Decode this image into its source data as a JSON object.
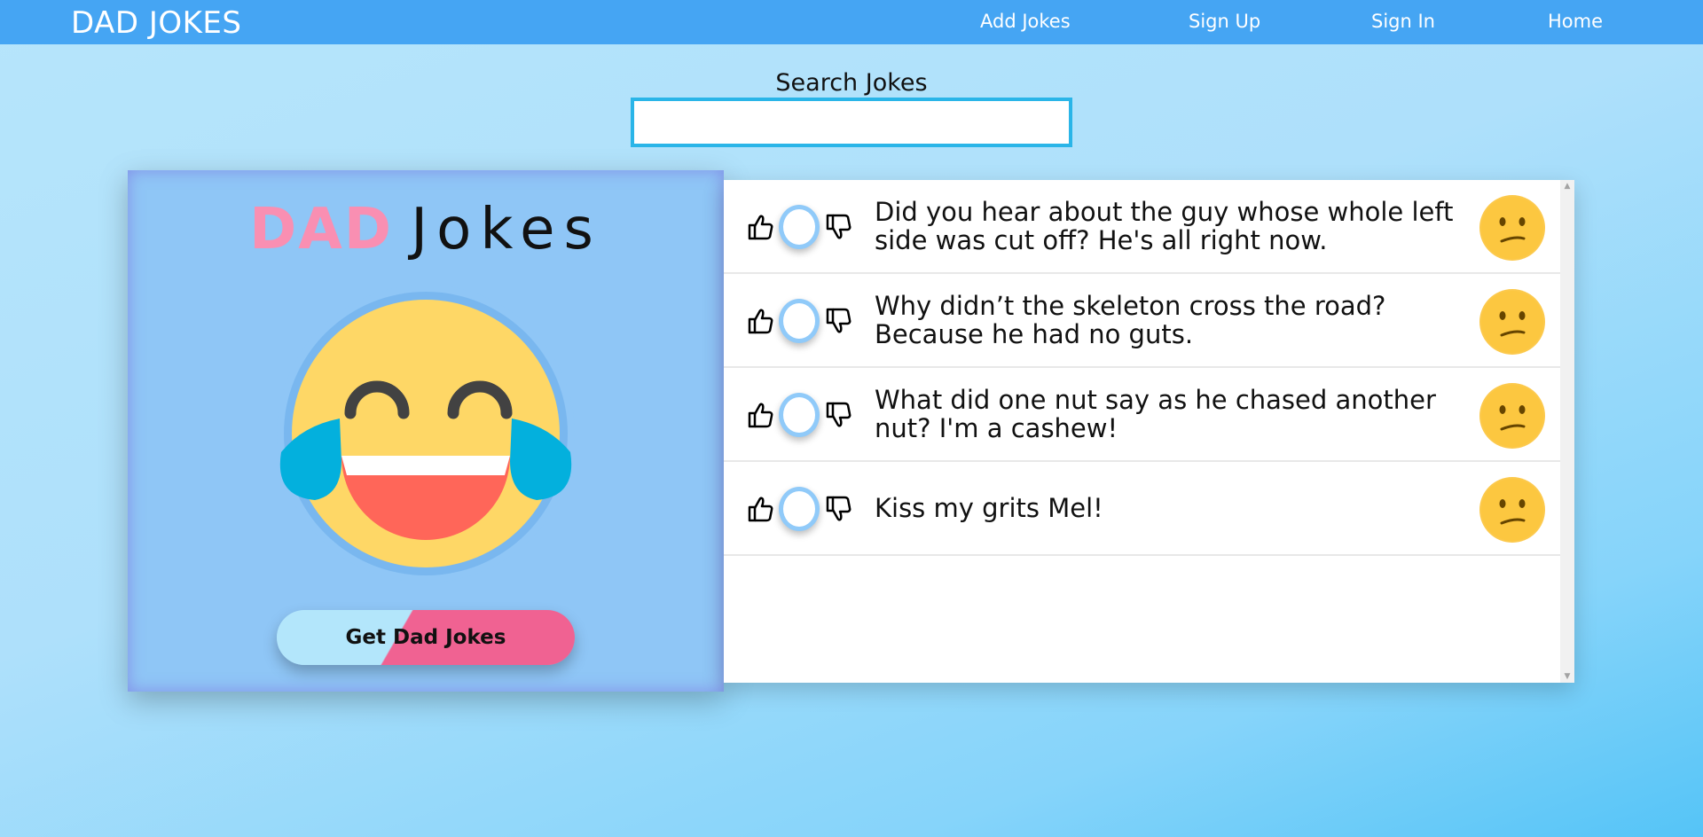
{
  "navbar": {
    "brand": "DAD JOKES",
    "links": [
      {
        "label": "Add Jokes"
      },
      {
        "label": "Sign Up"
      },
      {
        "label": "Sign In"
      },
      {
        "label": "Home"
      }
    ]
  },
  "search": {
    "label": "Search Jokes",
    "value": "",
    "placeholder": ""
  },
  "card": {
    "title_part1": "DAD",
    "title_part2": "Jokes",
    "emoji": "laughing-tears-emoji",
    "button_label": "Get Dad Jokes"
  },
  "jokes": [
    {
      "text": "Did you hear about the guy whose whole left side was cut off? He's all right now.",
      "rating_icon": "confused-face-emoji"
    },
    {
      "text": "Why didn’t the skeleton cross the road? Because he had no guts.",
      "rating_icon": "confused-face-emoji"
    },
    {
      "text": "What did one nut say as he chased another nut? I'm a cashew!",
      "rating_icon": "confused-face-emoji"
    },
    {
      "text": "Kiss my grits Mel!",
      "rating_icon": "confused-face-emoji"
    }
  ],
  "colors": {
    "navbar": "#45a5f3",
    "card": "#8fc6f6",
    "dad_pink": "#f98fb2",
    "button_pink": "#f06292",
    "button_blue": "#b3e6fb",
    "vote_ring": "#90caf9",
    "emoji_yellow": "#fed766"
  }
}
